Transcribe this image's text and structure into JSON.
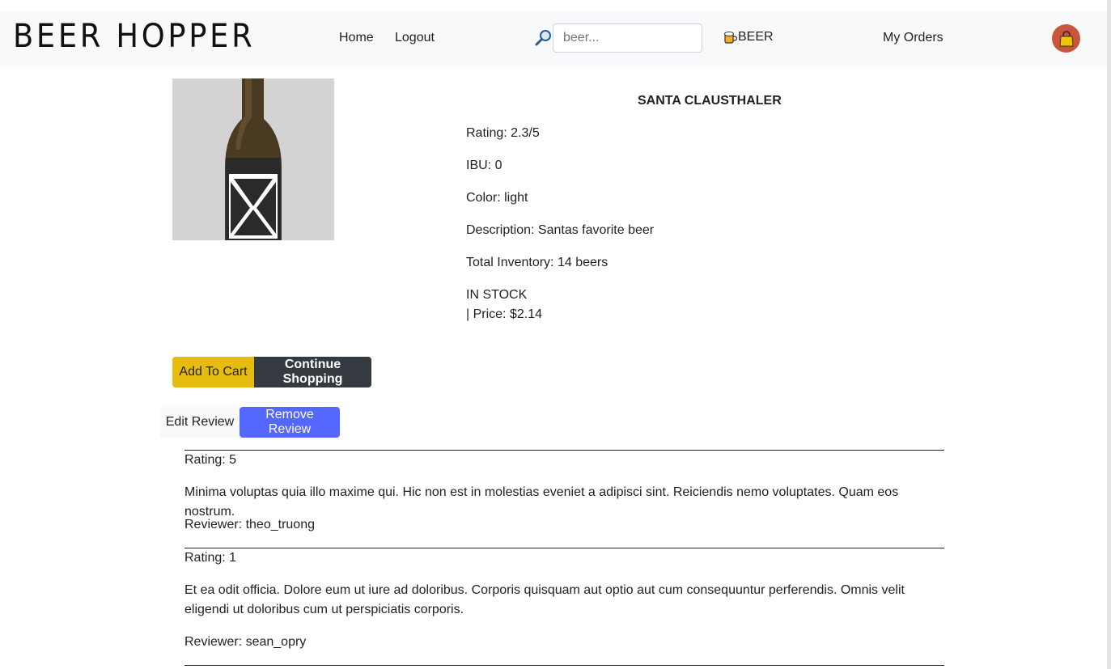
{
  "brand": "BEER HOPPER",
  "nav": {
    "home": "Home",
    "logout": "Logout",
    "search_placeholder": "beer...",
    "beer": "BEER",
    "orders": "My Orders"
  },
  "icons": {
    "search": "magnifier-icon",
    "beer": "beer-mug-icon",
    "cart": "shopping-bag-icon"
  },
  "colors": {
    "navbar_bg": "#f8f9fa",
    "add_to_cart": "#e6bd0f",
    "continue": "#343a40",
    "remove_review": "#5468ff",
    "cart_circle": "#c9553a"
  },
  "product": {
    "name": "SANTA CLAUSTHALER",
    "rating": "Rating: 2.3/5",
    "ibu": "IBU: 0",
    "color": "Color: light",
    "description": "Description: Santas favorite beer",
    "inventory": "Total Inventory: 14 beers",
    "stock": "IN STOCK",
    "price": "| Price: $2.14"
  },
  "actions": {
    "add_to_cart": "Add To Cart",
    "continue_shopping": "Continue Shopping",
    "edit_review": "Edit Review",
    "remove_review": "Remove Review"
  },
  "reviews": [
    {
      "rating": "Rating: 5",
      "text": "Minima voluptas quia illo maxime qui. Hic non est in molestias eveniet a adipisci sint. Reiciendis nemo voluptates. Quam eos nostrum.",
      "reviewer": "Reviewer: theo_truong"
    },
    {
      "rating": "Rating: 1",
      "text": "Et ea odit officia. Dolore eum ut iure ad doloribus. Corporis quisquam aut optio aut cum consequuntur perferendis. Omnis velit eligendi ut doloribus cum ut perspiciatis corporis.",
      "reviewer": "Reviewer: sean_opry"
    }
  ]
}
